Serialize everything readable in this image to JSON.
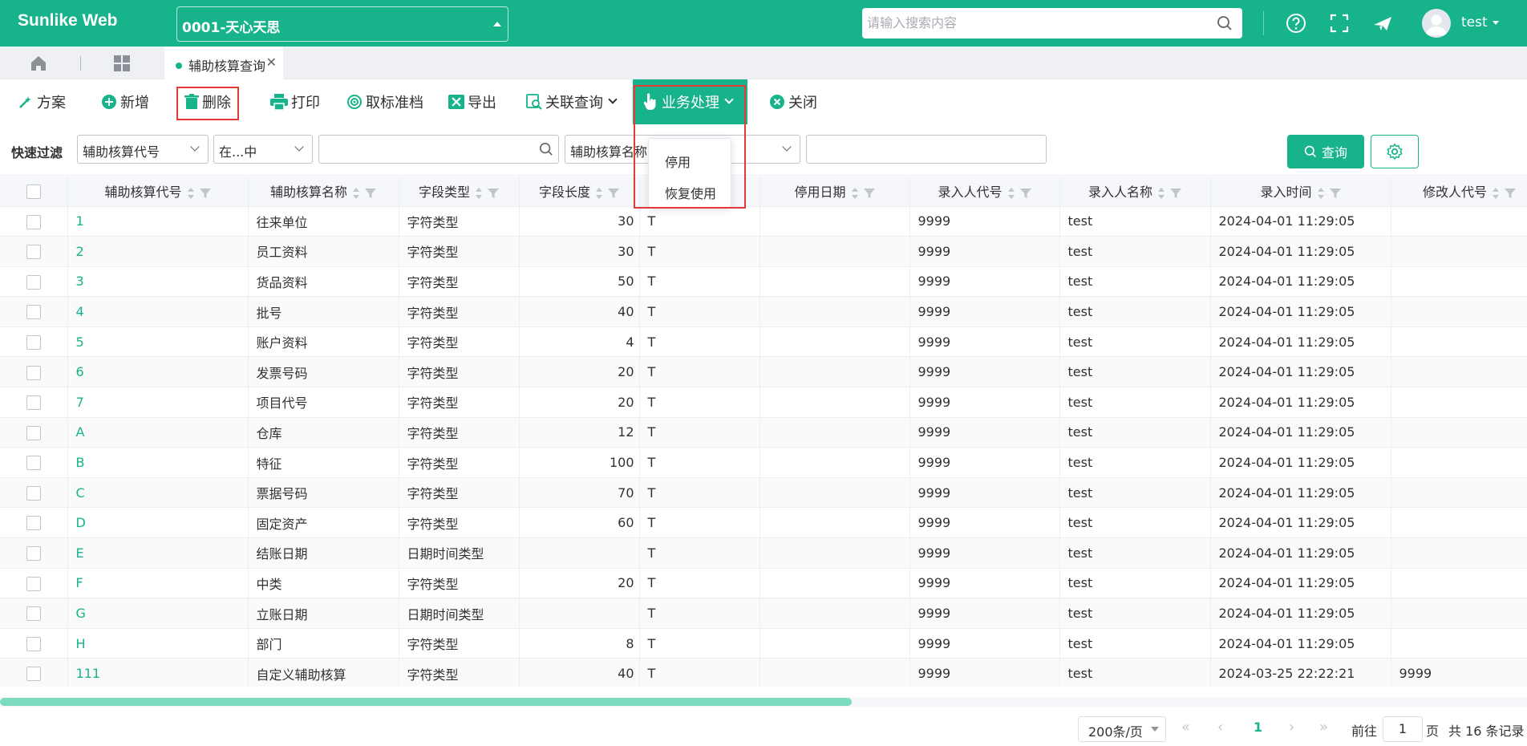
{
  "app": {
    "title": "Sunlike Web"
  },
  "header": {
    "company": "0001-天心天思",
    "search_placeholder": "请输入搜索内容",
    "user": "test"
  },
  "tabs": {
    "active_label": "辅助核算查询"
  },
  "toolbar": {
    "plan": "方案",
    "add": "新增",
    "delete": "删除",
    "print": "打印",
    "unmark": "取标准档",
    "export": "导出",
    "related": "关联查询",
    "business": "业务处理",
    "close": "关闭"
  },
  "dropdown": {
    "items": [
      "停用",
      "恢复使用"
    ]
  },
  "filter": {
    "label": "快速过滤",
    "field1": "辅助核算代号",
    "op1": "在...中",
    "field2": "辅助核算名称",
    "query": "查询"
  },
  "table": {
    "columns": [
      "辅助核算代号",
      "辅助核算名称",
      "字段类型",
      "字段长度",
      "",
      "停用日期",
      "录入人代号",
      "录入人名称",
      "录入时间",
      "修改人代号"
    ],
    "rows": [
      [
        "1",
        "往来单位",
        "字符类型",
        "30",
        "T",
        "",
        "9999",
        "test",
        "2024-04-01 11:29:05",
        ""
      ],
      [
        "2",
        "员工资料",
        "字符类型",
        "30",
        "T",
        "",
        "9999",
        "test",
        "2024-04-01 11:29:05",
        ""
      ],
      [
        "3",
        "货品资料",
        "字符类型",
        "50",
        "T",
        "",
        "9999",
        "test",
        "2024-04-01 11:29:05",
        ""
      ],
      [
        "4",
        "批号",
        "字符类型",
        "40",
        "T",
        "",
        "9999",
        "test",
        "2024-04-01 11:29:05",
        ""
      ],
      [
        "5",
        "账户资料",
        "字符类型",
        "4",
        "T",
        "",
        "9999",
        "test",
        "2024-04-01 11:29:05",
        ""
      ],
      [
        "6",
        "发票号码",
        "字符类型",
        "20",
        "T",
        "",
        "9999",
        "test",
        "2024-04-01 11:29:05",
        ""
      ],
      [
        "7",
        "项目代号",
        "字符类型",
        "20",
        "T",
        "",
        "9999",
        "test",
        "2024-04-01 11:29:05",
        ""
      ],
      [
        "A",
        "仓库",
        "字符类型",
        "12",
        "T",
        "",
        "9999",
        "test",
        "2024-04-01 11:29:05",
        ""
      ],
      [
        "B",
        "特征",
        "字符类型",
        "100",
        "T",
        "",
        "9999",
        "test",
        "2024-04-01 11:29:05",
        ""
      ],
      [
        "C",
        "票据号码",
        "字符类型",
        "70",
        "T",
        "",
        "9999",
        "test",
        "2024-04-01 11:29:05",
        ""
      ],
      [
        "D",
        "固定资产",
        "字符类型",
        "60",
        "T",
        "",
        "9999",
        "test",
        "2024-04-01 11:29:05",
        ""
      ],
      [
        "E",
        "结账日期",
        "日期时间类型",
        "",
        "T",
        "",
        "9999",
        "test",
        "2024-04-01 11:29:05",
        ""
      ],
      [
        "F",
        "中类",
        "字符类型",
        "20",
        "T",
        "",
        "9999",
        "test",
        "2024-04-01 11:29:05",
        ""
      ],
      [
        "G",
        "立账日期",
        "日期时间类型",
        "",
        "T",
        "",
        "9999",
        "test",
        "2024-04-01 11:29:05",
        ""
      ],
      [
        "H",
        "部门",
        "字符类型",
        "8",
        "T",
        "",
        "9999",
        "test",
        "2024-04-01 11:29:05",
        ""
      ],
      [
        "111",
        "自定义辅助核算",
        "字符类型",
        "40",
        "T",
        "",
        "9999",
        "test",
        "2024-03-25 22:22:21",
        "9999"
      ]
    ]
  },
  "pager": {
    "page_size": "200条/页",
    "current": "1",
    "goto_label": "前往",
    "goto_value": "1",
    "page_unit": "页",
    "total": "共 16 条记录"
  },
  "colors": {
    "brand": "#17b38a",
    "highlight": "#e53935"
  }
}
